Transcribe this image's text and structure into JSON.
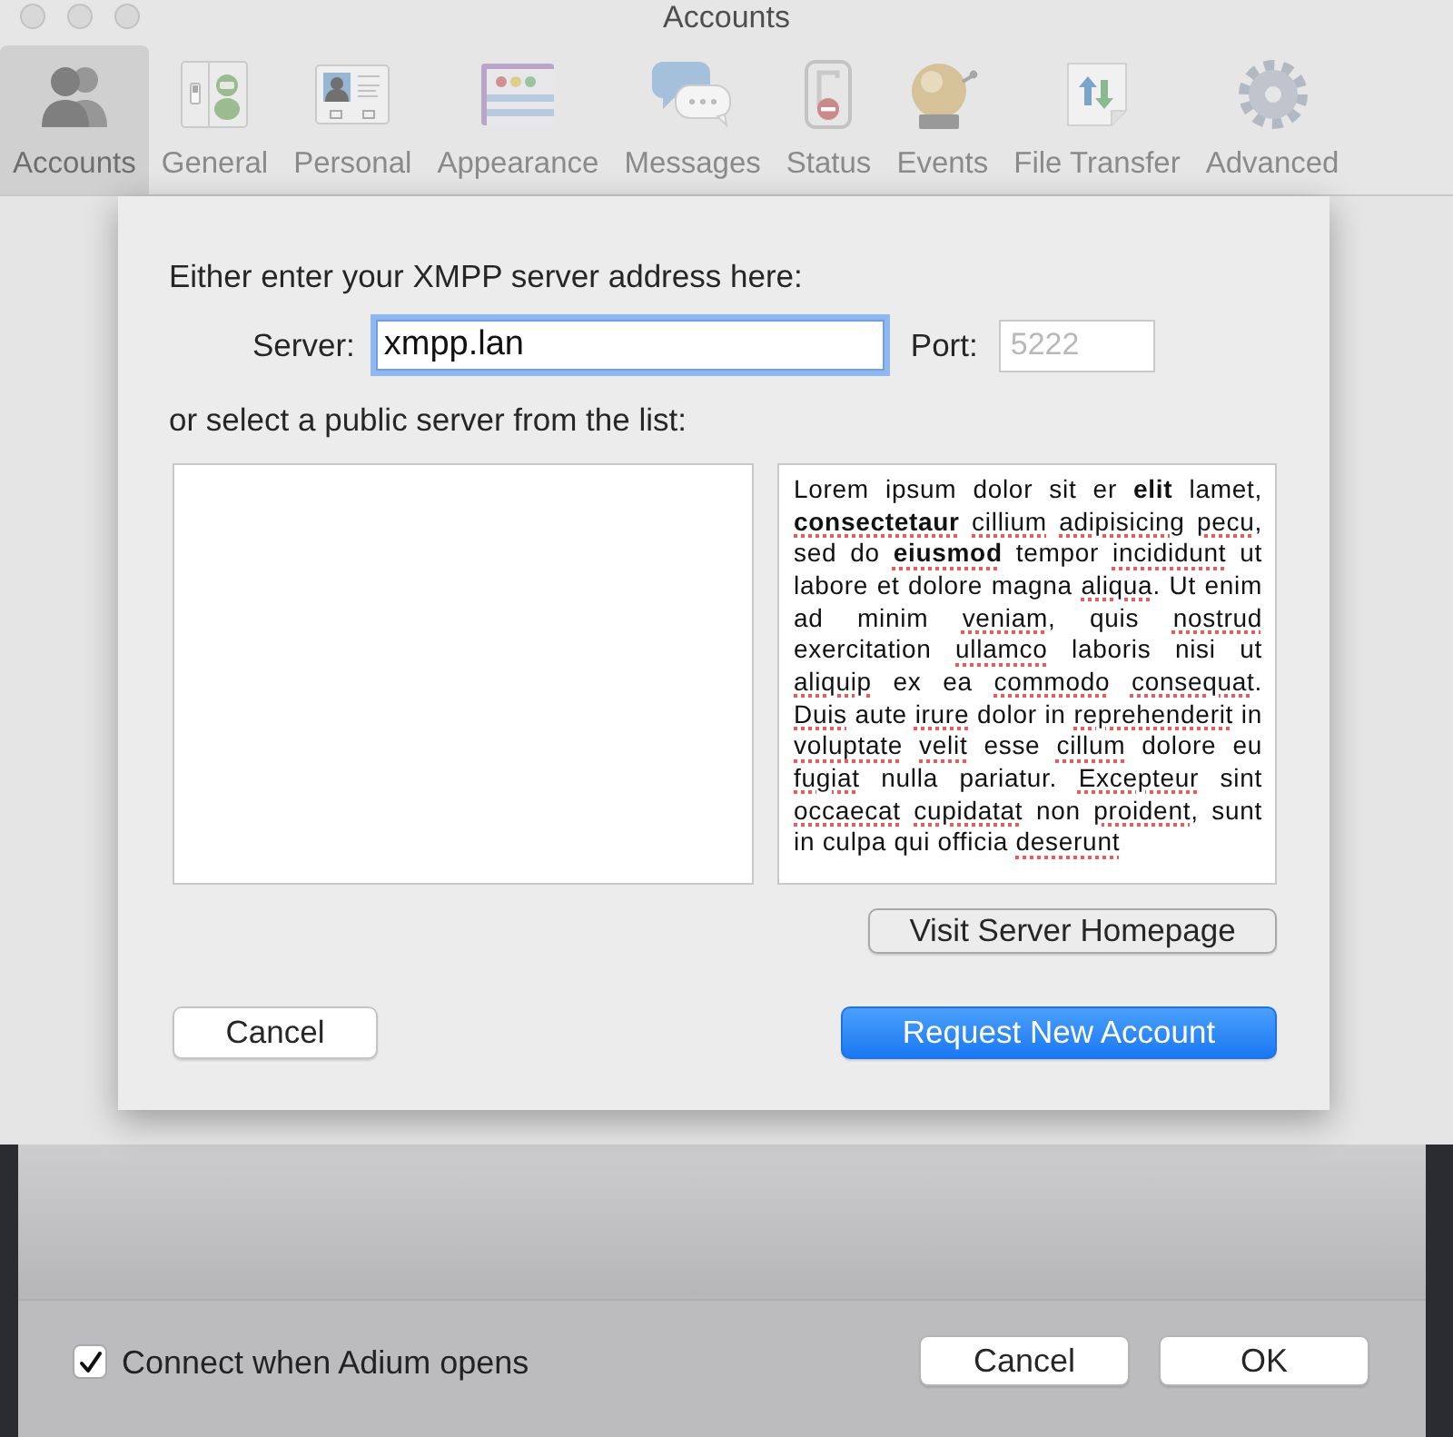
{
  "window": {
    "title": "Accounts"
  },
  "toolbar": {
    "tabs": [
      {
        "label": "Accounts",
        "selected": true
      },
      {
        "label": "General",
        "selected": false
      },
      {
        "label": "Personal",
        "selected": false
      },
      {
        "label": "Appearance",
        "selected": false
      },
      {
        "label": "Messages",
        "selected": false
      },
      {
        "label": "Status",
        "selected": false
      },
      {
        "label": "Events",
        "selected": false
      },
      {
        "label": "File Transfer",
        "selected": false
      },
      {
        "label": "Advanced",
        "selected": false
      }
    ]
  },
  "sheet": {
    "prompt": "Either enter your XMPP server address here:",
    "server": {
      "label": "Server:",
      "value": "xmpp.lan",
      "focused": true
    },
    "port": {
      "label": "Port:",
      "placeholder": "5222"
    },
    "list_prompt": "or select a public server from the list:",
    "description": {
      "runs": [
        {
          "text": "Lorem ipsum dolor sit er **elit** lamet, ",
          "misspelled": false
        },
        {
          "text": "**consectetaur** cillium adipisicing pecu",
          "misspelled": true
        },
        {
          "text": ", sed do ",
          "misspelled": false
        },
        {
          "text": "**eiusmod**",
          "misspelled": true
        },
        {
          "text": " tempor ",
          "misspelled": false
        },
        {
          "text": "incididunt",
          "misspelled": true
        },
        {
          "text": " ut labore et dolore magna ",
          "misspelled": false
        },
        {
          "text": "aliqua",
          "misspelled": true
        },
        {
          "text": ". Ut enim ad minim ",
          "misspelled": false
        },
        {
          "text": "veniam",
          "misspelled": true
        },
        {
          "text": ", quis ",
          "misspelled": false
        },
        {
          "text": "nostrud",
          "misspelled": true
        },
        {
          "text": " exercitation ",
          "misspelled": false
        },
        {
          "text": "ullamco",
          "misspelled": true
        },
        {
          "text": " laboris nisi ut ",
          "misspelled": false
        },
        {
          "text": "aliquip",
          "misspelled": true
        },
        {
          "text": " ex ea ",
          "misspelled": false
        },
        {
          "text": "commodo consequat",
          "misspelled": true
        },
        {
          "text": ". ",
          "misspelled": false
        },
        {
          "text": "Duis",
          "misspelled": true
        },
        {
          "text": " aute ",
          "misspelled": false
        },
        {
          "text": "irure",
          "misspelled": true
        },
        {
          "text": " dolor in ",
          "misspelled": false
        },
        {
          "text": "reprehenderit",
          "misspelled": true
        },
        {
          "text": " in ",
          "misspelled": false
        },
        {
          "text": "voluptate velit",
          "misspelled": true
        },
        {
          "text": " esse ",
          "misspelled": false
        },
        {
          "text": "cillum",
          "misspelled": true
        },
        {
          "text": " dolore eu ",
          "misspelled": false
        },
        {
          "text": "fugiat",
          "misspelled": true
        },
        {
          "text": " nulla pariatur. ",
          "misspelled": false
        },
        {
          "text": "Excepteur",
          "misspelled": true
        },
        {
          "text": " sint ",
          "misspelled": false
        },
        {
          "text": "occaecat cupidatat",
          "misspelled": true
        },
        {
          "text": " non ",
          "misspelled": false
        },
        {
          "text": "proident",
          "misspelled": true
        },
        {
          "text": ", sunt in culpa qui officia ",
          "misspelled": false
        },
        {
          "text": "deserunt",
          "misspelled": true
        }
      ]
    },
    "homepage_button": {
      "label": "Visit Server Homepage"
    },
    "cancel_button": {
      "label": "Cancel"
    },
    "request_button": {
      "label": "Request New Account",
      "default": true
    }
  },
  "footer": {
    "connect_checkbox": {
      "label": "Connect when Adium opens",
      "checked": true
    },
    "cancel_button": {
      "label": "Cancel"
    },
    "ok_button": {
      "label": "OK"
    }
  }
}
